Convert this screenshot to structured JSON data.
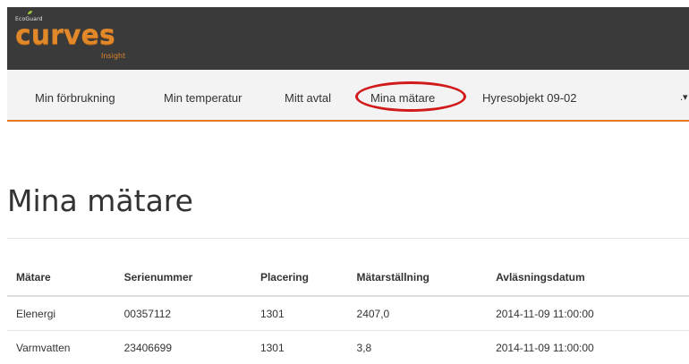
{
  "header": {
    "brand_small": "EcoGuard",
    "brand_main": "curves",
    "brand_sub": "Insight"
  },
  "nav": {
    "items": [
      {
        "label": "Min förbrukning"
      },
      {
        "label": "Min temperatur"
      },
      {
        "label": "Mitt avtal"
      },
      {
        "label": "Mina mätare",
        "active": true
      },
      {
        "label": "Hyresobjekt 09-02"
      }
    ],
    "more_caret": ".▾"
  },
  "page": {
    "title": "Mina mätare"
  },
  "table": {
    "columns": [
      "Mätare",
      "Serienummer",
      "Placering",
      "Mätarställning",
      "Avläsningsdatum"
    ],
    "rows": [
      [
        "Elenergi",
        "00357112",
        "1301",
        "2407,0",
        "2014-11-09 11:00:00"
      ],
      [
        "Varmvatten",
        "23406699",
        "1301",
        "3,8",
        "2014-11-09 11:00:00"
      ]
    ]
  },
  "colors": {
    "accent": "#e87722",
    "header_bg": "#3a3a3a",
    "highlight": "#d11a1a"
  }
}
